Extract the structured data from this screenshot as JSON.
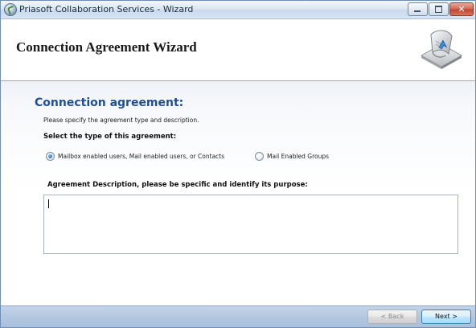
{
  "window": {
    "title": "Priasoft Collaboration Services - Wizard",
    "controls": {
      "minimize_icon": "minimize-icon",
      "maximize_icon": "maximize-icon",
      "close_label": "✕"
    }
  },
  "header": {
    "title": "Connection Agreement Wizard",
    "graphic_icon": "connection-agreement-icon"
  },
  "main": {
    "section_title": "Connection agreement:",
    "instruction": "Please specify the agreement type and description.",
    "type_label": "Select the type of this agreement:",
    "options": [
      {
        "label": "Mailbox enabled users, Mail enabled users, or Contacts",
        "selected": true
      },
      {
        "label": "Mail Enabled Groups",
        "selected": false
      }
    ],
    "description_label": "Agreement Description, please be specific and identify its purpose:",
    "description_value": ""
  },
  "footer": {
    "back_label": "< Back",
    "next_label": "Next >"
  },
  "colors": {
    "section_title": "#1f4e96",
    "footer_bar": "#b3c7df",
    "close_button": "#c04630"
  }
}
